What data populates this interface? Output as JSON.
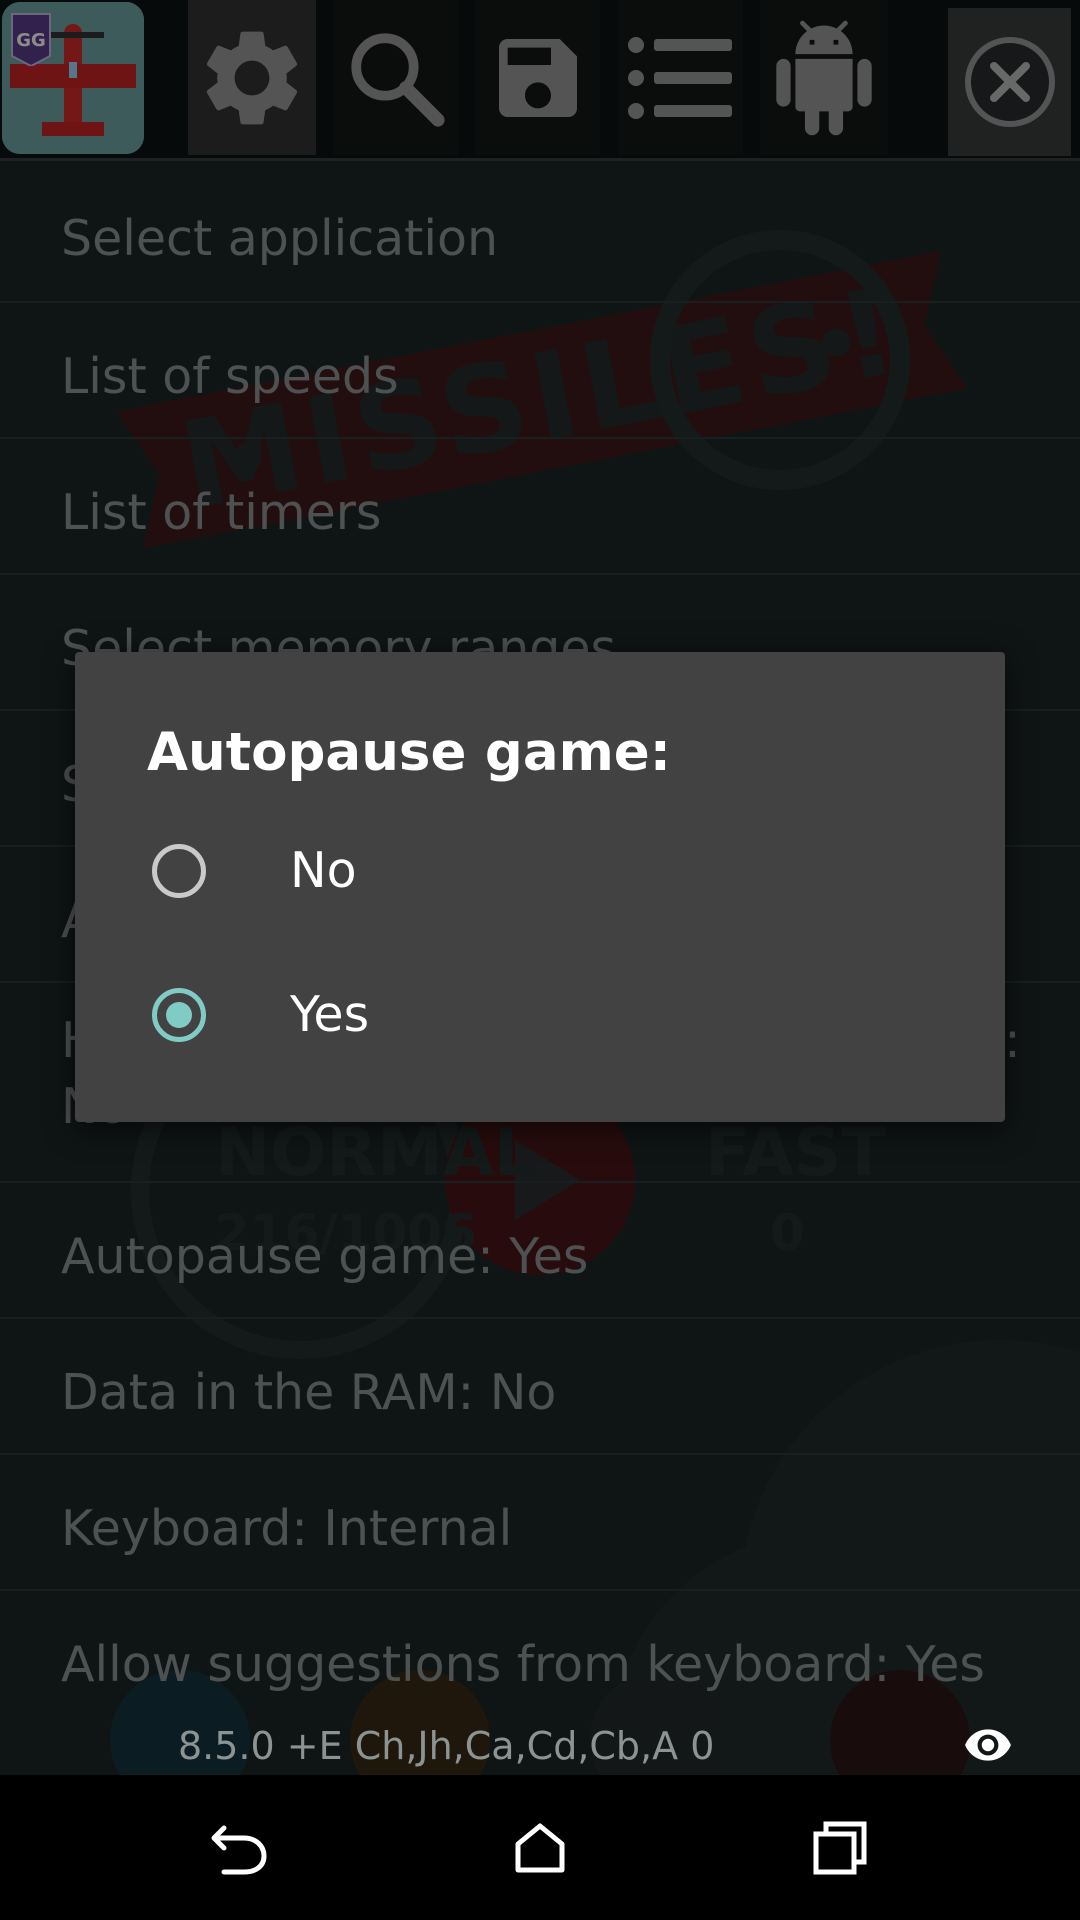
{
  "toolbar": {
    "app_icon": "plane-app-icon",
    "badge_icon": "gg-badge-icon",
    "buttons": [
      {
        "icon": "gear-icon"
      },
      {
        "icon": "search-icon"
      },
      {
        "icon": "floppy-disk-icon"
      },
      {
        "icon": "list-icon"
      },
      {
        "icon": "android-icon"
      },
      {
        "icon": "close-icon"
      }
    ]
  },
  "menu": {
    "items": [
      {
        "label": "Select application"
      },
      {
        "label": "List of speeds"
      },
      {
        "label": "List of timers"
      },
      {
        "label": "Select memory ranges"
      },
      {
        "label": "S"
      },
      {
        "label": "A"
      },
      {
        "label": "H",
        "label_end": "):",
        "label_cont": "No"
      },
      {
        "label": "Autopause game: Yes"
      },
      {
        "label": "Data in the RAM: No"
      },
      {
        "label": "Keyboard: Internal"
      },
      {
        "label": "Allow suggestions from keyboard: Yes"
      }
    ]
  },
  "game_bg": {
    "banner": "MISSILES!",
    "mode_left": "NORMAL",
    "mode_right": "FAST",
    "score_left": "216/1006",
    "score_right": "0"
  },
  "dialog": {
    "title": "Autopause game:",
    "options": [
      {
        "label": "No",
        "selected": false
      },
      {
        "label": "Yes",
        "selected": true
      }
    ],
    "accent_color": "#80cbc4"
  },
  "status": {
    "text": "8.5.0   +E Ch,Jh,Ca,Cd,Cb,A   0",
    "icon": "eye-icon"
  },
  "navbar": {
    "buttons": [
      {
        "icon": "back-icon"
      },
      {
        "icon": "home-icon"
      },
      {
        "icon": "recent-apps-icon"
      }
    ]
  }
}
